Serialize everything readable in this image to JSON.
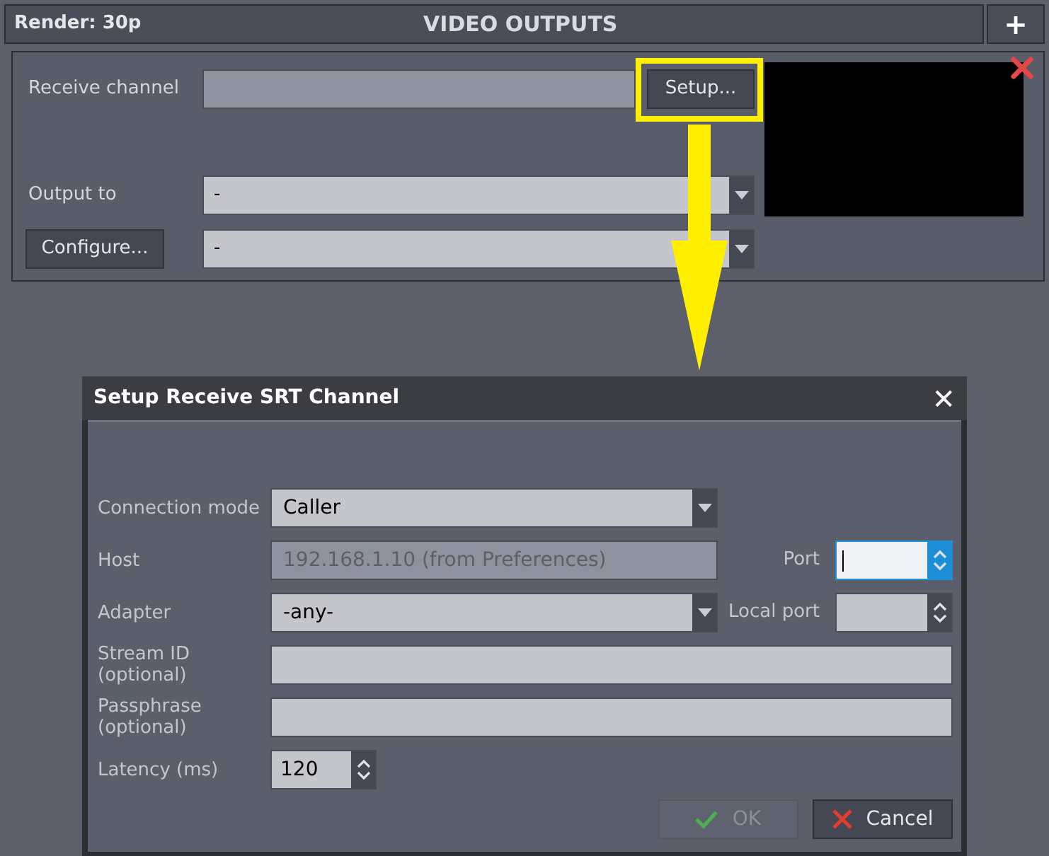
{
  "header": {
    "render_label": "Render: 30p",
    "title": "VIDEO OUTPUTS",
    "add_button": "+"
  },
  "output_panel": {
    "receive_label": "Receive channel",
    "setup_button": {
      "label": "Setup...",
      "highlighted": true
    },
    "output_label": "Output to",
    "output_value": "-",
    "configure_button": "Configure...",
    "configure_value": "-"
  },
  "dialog": {
    "title": "Setup Receive SRT Channel",
    "close": "✕",
    "rows": [
      {
        "label": "Connection mode",
        "kind": "dropdown",
        "value": "Caller"
      },
      {
        "label": "Host",
        "kind": "text",
        "value": "192.168.1.10 (from Preferences)",
        "disabled": true,
        "side": {
          "label": "Port",
          "focused": true
        }
      },
      {
        "label": "Adapter",
        "kind": "dropdown",
        "value": "-any-",
        "side": {
          "label": "Local port",
          "focused": false
        }
      },
      {
        "label": "Stream ID (optional)",
        "kind": "wide"
      },
      {
        "label": "Passphrase (optional)",
        "kind": "wide"
      },
      {
        "label": "Latency (ms)",
        "kind": "spinner",
        "value": "120"
      }
    ],
    "buttons": [
      {
        "label": "OK",
        "kind": "ok",
        "disabled": true
      },
      {
        "label": "Cancel",
        "kind": "cancel",
        "disabled": false
      }
    ]
  }
}
